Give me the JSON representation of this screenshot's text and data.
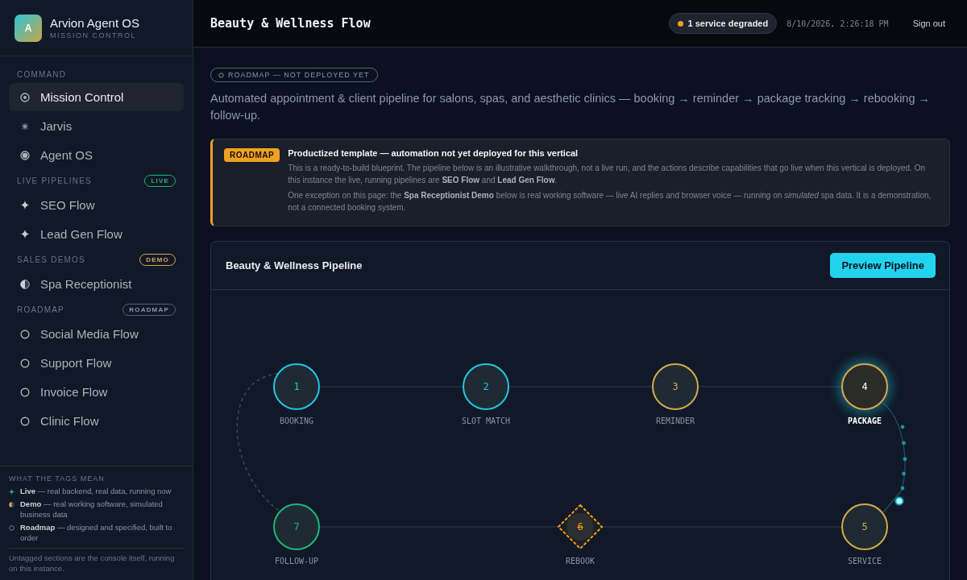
{
  "brand": {
    "logo": "A",
    "name": "Arvion Agent OS",
    "subtitle": "MISSION CONTROL"
  },
  "sidebar": {
    "sections": [
      {
        "title": "COMMAND",
        "items": [
          {
            "label": "Mission Control",
            "kind": "target",
            "selected": true
          },
          {
            "label": "Jarvis",
            "kind": "burst",
            "selected": false
          },
          {
            "label": "Agent OS",
            "kind": "radio",
            "selected": false
          }
        ]
      },
      {
        "title": "LIVE PIPELINES",
        "badge": {
          "label": "LIVE",
          "kind": "live"
        },
        "items": [
          {
            "label": "SEO Flow",
            "kind": "sparkle",
            "selected": false
          },
          {
            "label": "Lead Gen Flow",
            "kind": "sparkle",
            "selected": false
          }
        ]
      },
      {
        "title": "SALES DEMOS",
        "badge": {
          "label": "DEMO",
          "kind": "demo"
        },
        "items": [
          {
            "label": "Spa Receptionist",
            "kind": "half",
            "selected": false
          }
        ]
      },
      {
        "title": "ROADMAP",
        "badge": {
          "label": "ROADMAP",
          "kind": "roadmap"
        },
        "items": [
          {
            "label": "Social Media Flow",
            "kind": "ring",
            "selected": false
          },
          {
            "label": "Support Flow",
            "kind": "ring",
            "selected": false
          },
          {
            "label": "Invoice Flow",
            "kind": "ring",
            "selected": false
          },
          {
            "label": "Clinic Flow",
            "kind": "ring",
            "selected": false
          }
        ]
      }
    ]
  },
  "legend": {
    "title": "WHAT THE TAGS MEAN",
    "items": [
      {
        "kind": "live",
        "text": "**Live** — real backend, real data, running now"
      },
      {
        "kind": "demo",
        "text": "**Demo** — real working software, simulated business data"
      },
      {
        "kind": "roadmap",
        "text": "**Roadmap** — designed and specified, built to order"
      }
    ],
    "note": "Untagged sections are the console itself, running on this instance."
  },
  "topbar": {
    "title": "Beauty & Wellness Flow",
    "status": "1 service degraded",
    "timestamp": "8/10/2026, 2:26:18 PM",
    "signout": "Sign out"
  },
  "status_tag": "ROADMAP — NOT DEPLOYED YET",
  "description": "Automated appointment & client pipeline for salons, spas, and aesthetic clinics — booking → reminder → package tracking → rebooking → follow-up.",
  "notice": {
    "tag": "ROADMAP",
    "title": "Productized template — automation not yet deployed for this vertical",
    "paragraphs": [
      "This is a ready-to-build blueprint. The pipeline below is an illustrative walkthrough, not a live run, and the actions describe capabilities that go live when this vertical is deployed. On this instance the live, running pipelines are **SEO Flow** and **Lead Gen Flow**.",
      "One exception on this page: the **Spa Receptionist Demo** below is real working software — live AI replies and browser voice — running on *simulated* spa data. It is a demonstration, not a connected booking system."
    ]
  },
  "pipeline": {
    "title": "Beauty & Wellness Pipeline",
    "button": "Preview Pipeline",
    "nodes": [
      {
        "number": "1",
        "label": "BOOKING",
        "kind": "circle",
        "color": "#22c5e0",
        "selected": false
      },
      {
        "number": "2",
        "label": "SLOT MATCH",
        "kind": "circle",
        "color": "#22c5e0",
        "selected": false
      },
      {
        "number": "3",
        "label": "REMINDER",
        "kind": "circle",
        "color": "#d4a94a",
        "selected": false
      },
      {
        "number": "4",
        "label": "PACKAGE",
        "kind": "circle",
        "color": "#d4a94a",
        "selected": true
      },
      {
        "number": "7",
        "label": "FOLLOW-UP",
        "kind": "circle",
        "color": "#1fb57a",
        "selected": false
      },
      {
        "number": "6",
        "label": "REBOOK",
        "kind": "diamond",
        "color": "#f39c12",
        "selected": false
      },
      {
        "number": "5",
        "label": "SERVICE",
        "kind": "circle",
        "color": "#d4a94a",
        "selected": false
      }
    ]
  }
}
